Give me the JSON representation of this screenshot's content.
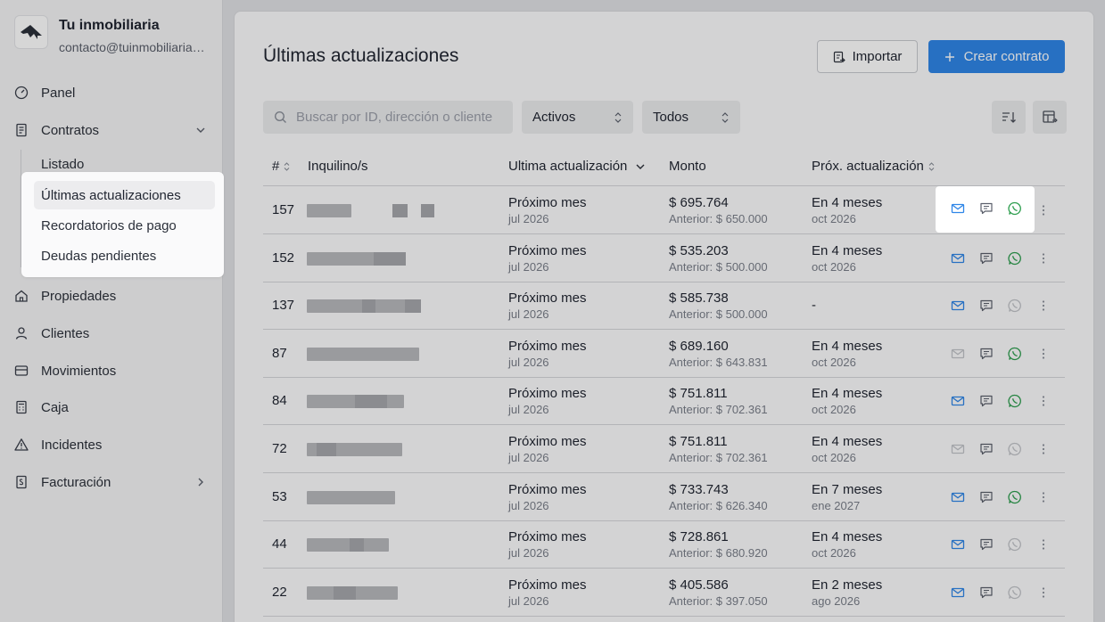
{
  "brand": {
    "name": "Tu inmobiliaria",
    "email": "contacto@tuinmobiliaria.com"
  },
  "nav": {
    "panel": "Panel",
    "contratos": "Contratos",
    "propiedades": "Propiedades",
    "clientes": "Clientes",
    "movimientos": "Movimientos",
    "caja": "Caja",
    "incidentes": "Incidentes",
    "facturacion": "Facturación"
  },
  "submenu": {
    "listado": "Listado",
    "ultimas": "Últimas actualizaciones",
    "recordatorios": "Recordatorios de pago",
    "deudas": "Deudas pendientes"
  },
  "header": {
    "title": "Últimas actualizaciones",
    "import_label": "Importar",
    "create_label": "Crear contrato"
  },
  "filters": {
    "search_placeholder": "Buscar por ID, dirección o cliente",
    "status": "Activos",
    "type": "Todos"
  },
  "table": {
    "columns": {
      "id": "#",
      "tenant": "Inquilino/s",
      "last_update": "Ultima actualización",
      "amount": "Monto",
      "next_update": "Próx. actualización"
    },
    "rows": [
      {
        "id": "157",
        "last": "Próximo mes",
        "last_date": "jul 2026",
        "amount": "$ 695.764",
        "previous": "Anterior: $ 650.000",
        "next": "En 4 meses",
        "next_date": "oct 2026"
      },
      {
        "id": "152",
        "last": "Próximo mes",
        "last_date": "jul 2026",
        "amount": "$ 535.203",
        "previous": "Anterior: $ 500.000",
        "next": "En 4 meses",
        "next_date": "oct 2026"
      },
      {
        "id": "137",
        "last": "Próximo mes",
        "last_date": "jul 2026",
        "amount": "$ 585.738",
        "previous": "Anterior: $ 500.000",
        "next": "-",
        "next_date": ""
      },
      {
        "id": "87",
        "last": "Próximo mes",
        "last_date": "jul 2026",
        "amount": "$ 689.160",
        "previous": "Anterior: $ 643.831",
        "next": "En 4 meses",
        "next_date": "oct 2026"
      },
      {
        "id": "84",
        "last": "Próximo mes",
        "last_date": "jul 2026",
        "amount": "$ 751.811",
        "previous": "Anterior: $ 702.361",
        "next": "En 4 meses",
        "next_date": "oct 2026"
      },
      {
        "id": "72",
        "last": "Próximo mes",
        "last_date": "jul 2026",
        "amount": "$ 751.811",
        "previous": "Anterior: $ 702.361",
        "next": "En 4 meses",
        "next_date": "oct 2026"
      },
      {
        "id": "53",
        "last": "Próximo mes",
        "last_date": "jul 2026",
        "amount": "$ 733.743",
        "previous": "Anterior: $ 626.340",
        "next": "En 7 meses",
        "next_date": "ene 2027"
      },
      {
        "id": "44",
        "last": "Próximo mes",
        "last_date": "jul 2026",
        "amount": "$ 728.861",
        "previous": "Anterior: $ 680.920",
        "next": "En 4 meses",
        "next_date": "oct 2026"
      },
      {
        "id": "22",
        "last": "Próximo mes",
        "last_date": "jul 2026",
        "amount": "$ 405.586",
        "previous": "Anterior: $ 397.050",
        "next": "En 2 meses",
        "next_date": "ago 2026"
      }
    ]
  },
  "colors": {
    "accent": "#2f86e8",
    "whatsapp": "#2e9e4f",
    "mail": "#2f86e8"
  }
}
